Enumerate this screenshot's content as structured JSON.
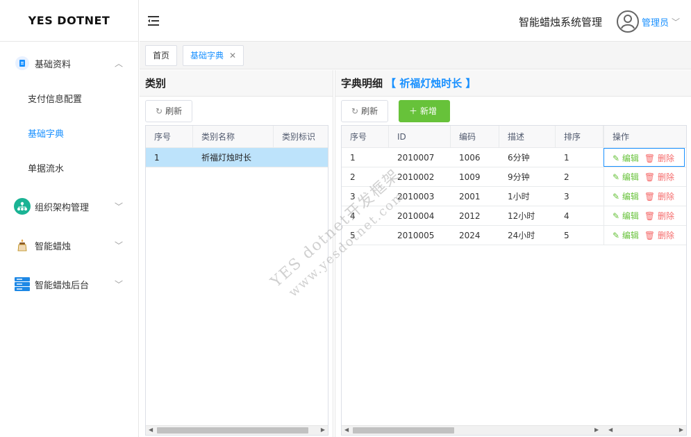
{
  "app": {
    "logo": "YES DOTNET",
    "system_title": "智能蜡烛系统管理",
    "user_name": "管理员"
  },
  "sidebar": {
    "groups": [
      {
        "label": "基础资料",
        "icon": "document-icon",
        "expanded": true,
        "children": [
          {
            "label": "支付信息配置"
          },
          {
            "label": "基础字典",
            "active": true
          },
          {
            "label": "单据流水"
          }
        ]
      },
      {
        "label": "组织架构管理",
        "icon": "org-chart-icon"
      },
      {
        "label": "智能蜡烛",
        "icon": "candle-icon"
      },
      {
        "label": "智能蜡烛后台",
        "icon": "server-icon"
      }
    ]
  },
  "tabs": [
    {
      "label": "首页"
    },
    {
      "label": "基础字典",
      "active": true,
      "closable": true
    }
  ],
  "left_panel": {
    "title": "类别",
    "refresh_label": "刷新",
    "columns": [
      "序号",
      "类别名称",
      "类别标识"
    ],
    "rows": [
      [
        "1",
        "祈福灯烛时长",
        ""
      ]
    ]
  },
  "right_panel": {
    "title": "字典明细",
    "title_accent": "【 祈福灯烛时长 】",
    "refresh_label": "刷新",
    "add_label": "新增",
    "columns": [
      "序号",
      "ID",
      "编码",
      "描述",
      "排序",
      "操作"
    ],
    "rows": [
      [
        "1",
        "2010007",
        "1006",
        "6分钟",
        "1"
      ],
      [
        "2",
        "2010002",
        "1009",
        "9分钟",
        "2"
      ],
      [
        "3",
        "2010003",
        "2001",
        "1小时",
        "3"
      ],
      [
        "4",
        "2010004",
        "2012",
        "12小时",
        "4"
      ],
      [
        "5",
        "2010005",
        "2024",
        "24小时",
        "5"
      ]
    ],
    "edit_label": "编辑",
    "delete_label": "删除"
  },
  "watermark": {
    "line1": "YES dotnet开发框架",
    "line2": "www.yesdotnet.com"
  },
  "colors": {
    "primary": "#1890ff",
    "success": "#67c23a",
    "danger": "#f56c6c",
    "selected_row": "#bde3fb"
  }
}
